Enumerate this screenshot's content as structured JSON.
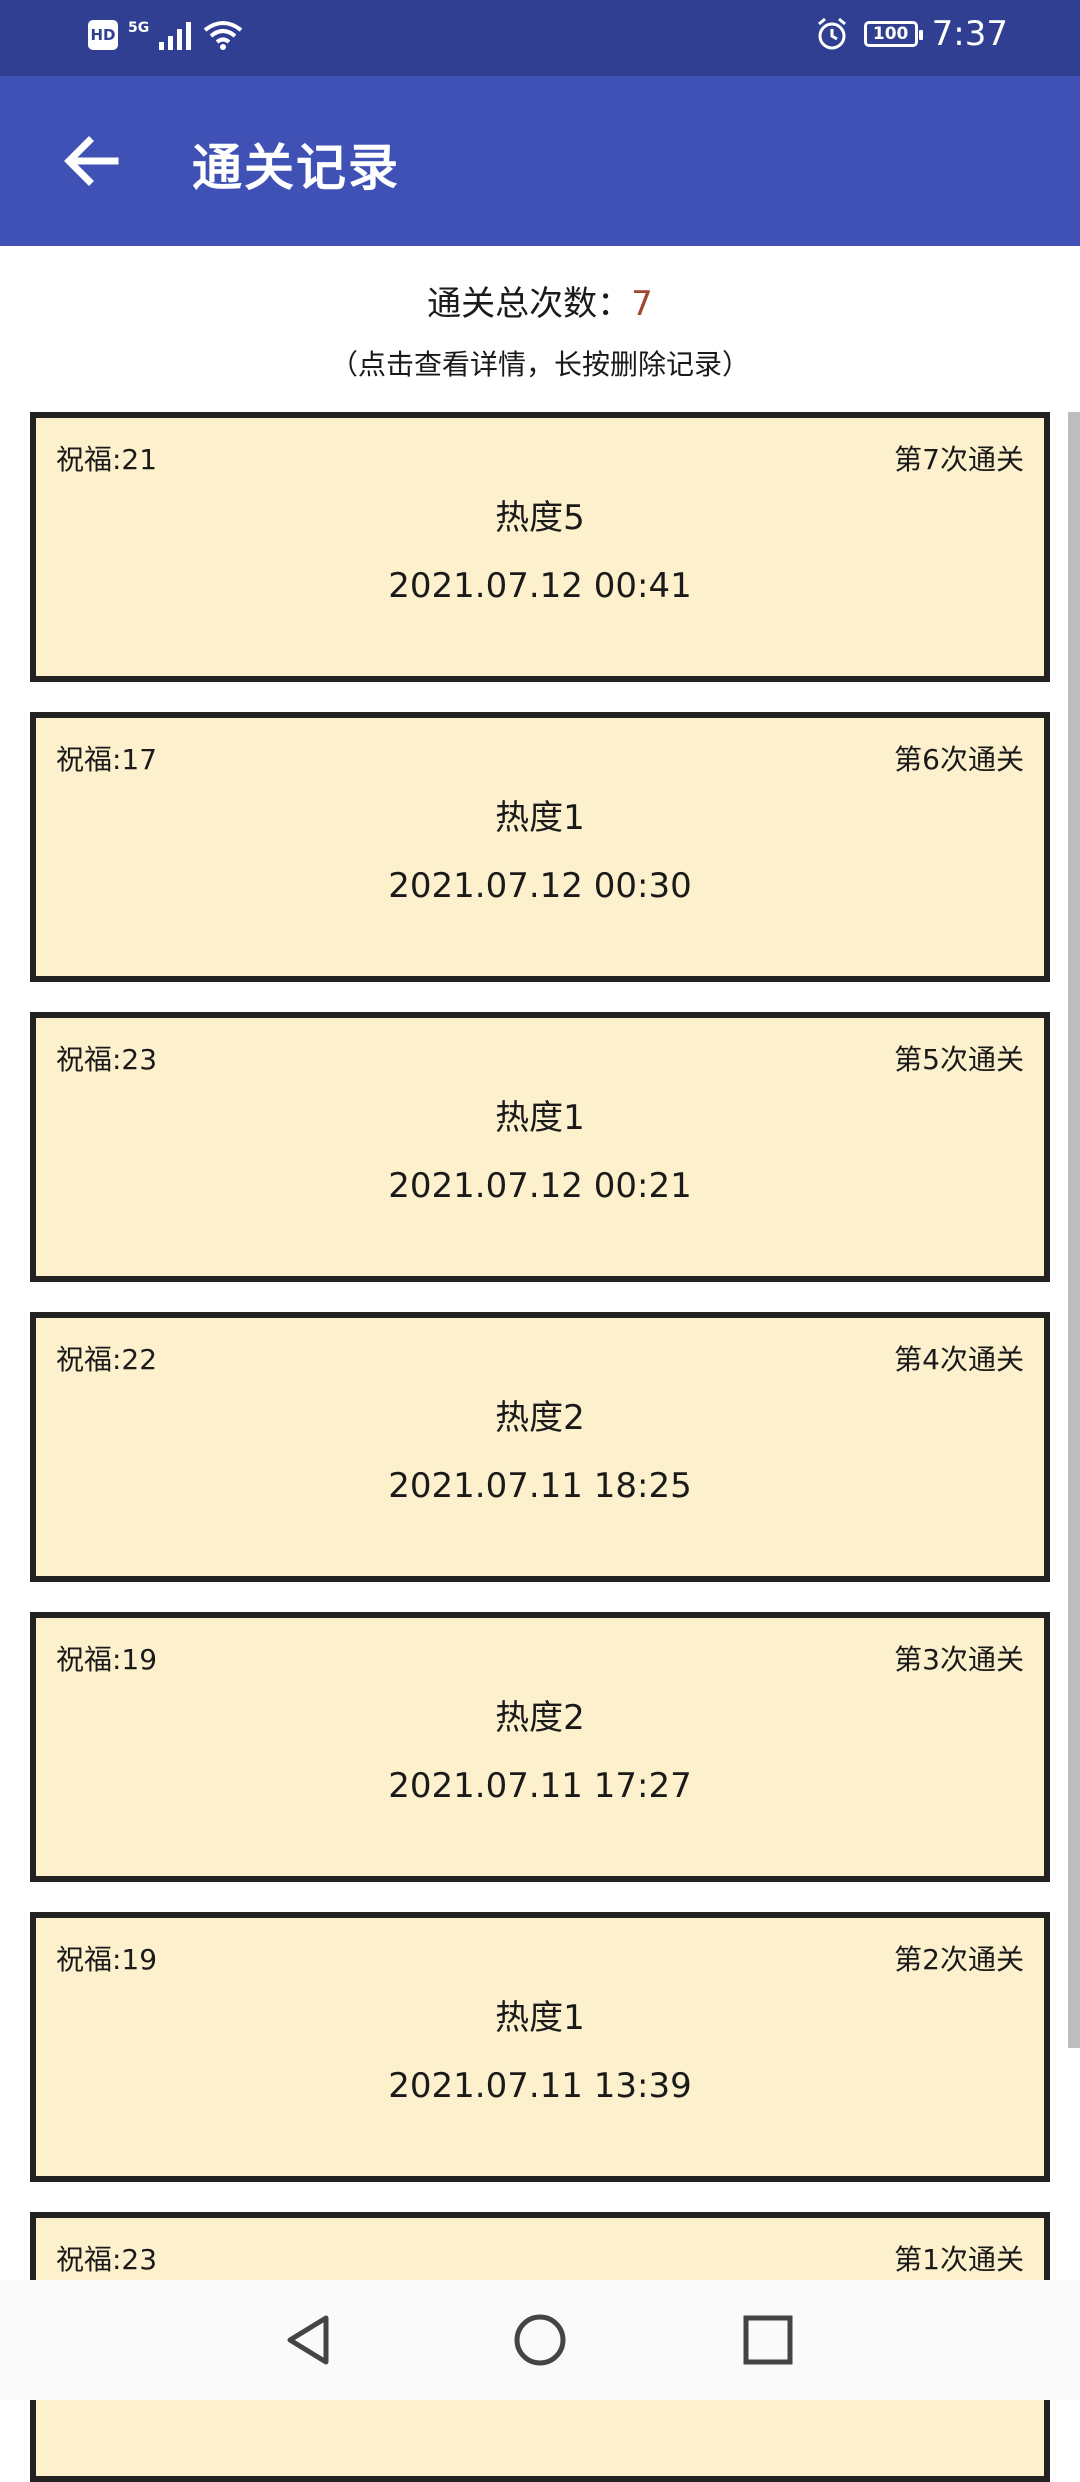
{
  "status_bar": {
    "hd": "HD",
    "network": "5G",
    "battery": "100",
    "time": "7:37"
  },
  "app_bar": {
    "title": "通关记录"
  },
  "summary": {
    "total_label": "通关总次数：",
    "total_count": "7",
    "hint": "（点击查看详情，长按删除记录）",
    "count_color": "#a0472c"
  },
  "records": [
    {
      "blessing": "祝福:21",
      "index": "第7次通关",
      "heat": "热度5",
      "date": "2021.07.12 00:41"
    },
    {
      "blessing": "祝福:17",
      "index": "第6次通关",
      "heat": "热度1",
      "date": "2021.07.12 00:30"
    },
    {
      "blessing": "祝福:23",
      "index": "第5次通关",
      "heat": "热度1",
      "date": "2021.07.12 00:21"
    },
    {
      "blessing": "祝福:22",
      "index": "第4次通关",
      "heat": "热度2",
      "date": "2021.07.11 18:25"
    },
    {
      "blessing": "祝福:19",
      "index": "第3次通关",
      "heat": "热度2",
      "date": "2021.07.11 17:27"
    },
    {
      "blessing": "祝福:19",
      "index": "第2次通关",
      "heat": "热度1",
      "date": "2021.07.11 13:39"
    },
    {
      "blessing": "祝福:23",
      "index": "第1次通关",
      "heat": "",
      "date": ""
    }
  ],
  "colors": {
    "status_bar": "#303f92",
    "app_bar": "#3f51b5",
    "card_background": "#fdf0cd",
    "card_border": "#222222"
  }
}
